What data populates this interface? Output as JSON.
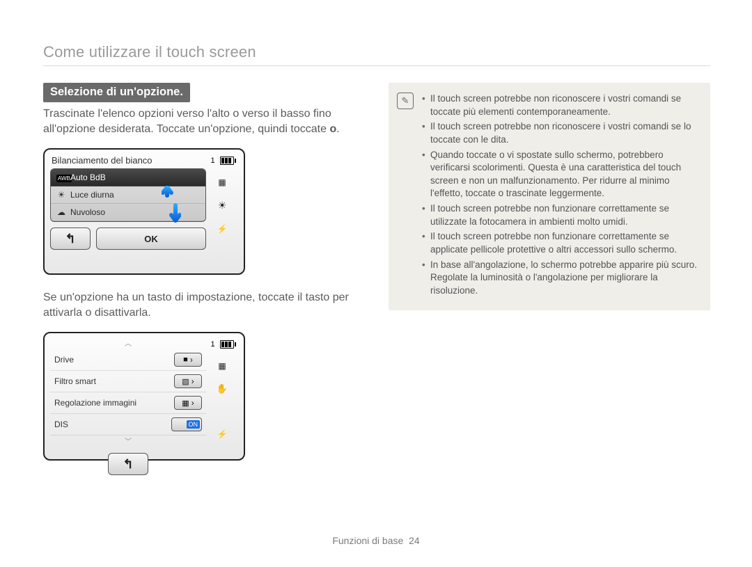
{
  "page_title": "Come utilizzare il touch screen",
  "section_heading": "Selezione di un'opzione.",
  "intro_text": "Trascinate l'elenco opzioni verso l'alto o verso il basso fino all'opzione desiderata. Toccate un'opzione, quindi toccate ",
  "intro_ok_symbol": "o",
  "intro_tail": ".",
  "device1": {
    "title": "Bilanciamento del bianco",
    "items": [
      {
        "icon_name": "awb-badge",
        "icon_text": "AWB",
        "label": "Auto BdB",
        "active": true
      },
      {
        "icon_name": "sun-icon",
        "icon_text": "☀",
        "label": "Luce diurna",
        "active": false
      },
      {
        "icon_name": "cloud-icon",
        "icon_text": "☁",
        "label": "Nuvoloso",
        "active": false
      }
    ],
    "back_label": "↰",
    "ok_label": "OK",
    "side": {
      "counter": "1",
      "icons": [
        "battery",
        "grid",
        "light",
        "flash"
      ]
    }
  },
  "mid_text": "Se un'opzione ha un tasto di impostazione, toccate il tasto per attivarla o disattivarla.",
  "device2": {
    "items": [
      {
        "label": "Drive",
        "value_icon": "single-frame-icon",
        "value_glyph": "■",
        "kind": "chevron"
      },
      {
        "label": "Filtro smart",
        "value_icon": "filter-icon",
        "value_glyph": "▧",
        "kind": "chevron"
      },
      {
        "label": "Regolazione immagini",
        "value_icon": "adjust-icon",
        "value_glyph": "▦",
        "kind": "chevron"
      },
      {
        "label": "DIS",
        "value_icon": "dis-toggle",
        "value_glyph": "ON",
        "kind": "on"
      }
    ],
    "back_label": "↰",
    "side": {
      "counter": "1",
      "icons": [
        "battery",
        "grid",
        "hand",
        "blank",
        "flash"
      ]
    }
  },
  "note": {
    "items": [
      "Il touch screen potrebbe non riconoscere i vostri comandi se toccate più elementi contemporaneamente.",
      "Il touch screen potrebbe non riconoscere i vostri comandi se lo toccate con le dita.",
      "Quando toccate o vi spostate sullo schermo, potrebbero verificarsi scolorimenti. Questa è una caratteristica del touch screen e non un malfunzionamento. Per ridurre al minimo l'effetto, toccate o trascinate leggermente.",
      "Il touch screen potrebbe non funzionare correttamente se utilizzate la fotocamera in ambienti molto umidi.",
      "Il touch screen potrebbe non funzionare correttamente se applicate pellicole protettive o altri accessori sullo schermo.",
      "In base all'angolazione, lo schermo potrebbe apparire più scuro. Regolate la luminosità o l'angolazione per migliorare la risoluzione."
    ]
  },
  "footer": {
    "section": "Funzioni di base",
    "page": "24"
  }
}
